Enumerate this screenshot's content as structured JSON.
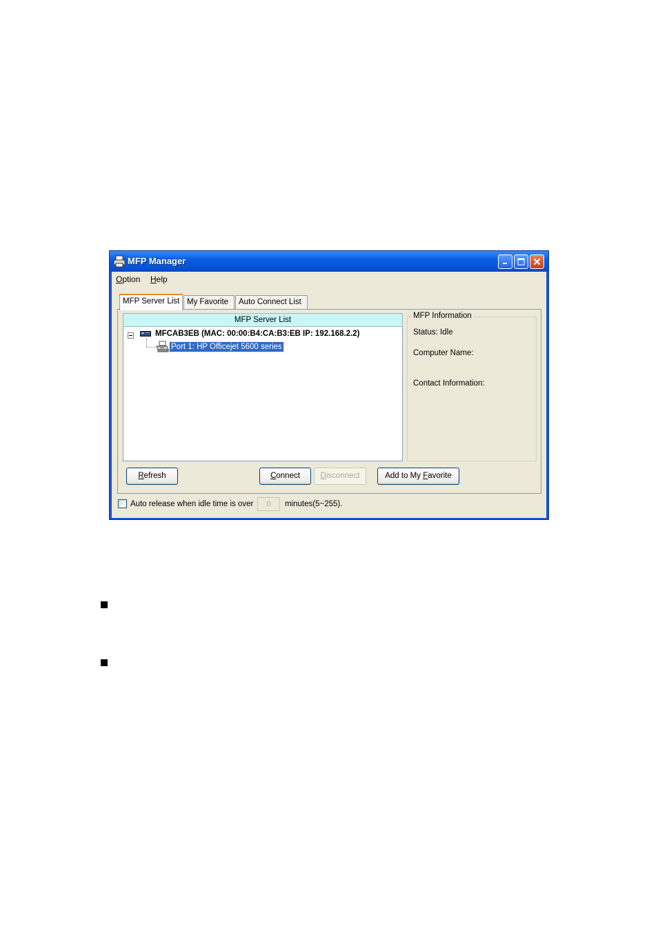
{
  "window": {
    "title": "MFP Manager",
    "colors": {
      "titlebar": "#0654d8",
      "client": "#ece9d8",
      "selection": "#316ac5",
      "list_header": "#c8f5f5"
    }
  },
  "menu": {
    "option": {
      "accel": "O",
      "rest": "ption"
    },
    "help": {
      "accel": "H",
      "rest": "elp"
    }
  },
  "tabs": [
    {
      "label": "MFP Server List",
      "active": true
    },
    {
      "label": "My Favorite",
      "active": false
    },
    {
      "label": "Auto Connect List",
      "active": false
    }
  ],
  "server_list": {
    "header": "MFP Server List",
    "server": {
      "label": "MFCAB3EB (MAC: 00:00:B4:CA:B3:EB   IP: 192.168.2.2)",
      "icon": "server-icon",
      "expanded": true
    },
    "port": {
      "label": "Port 1: HP Officejet 5600 series",
      "icon": "printer-icon",
      "selected": true
    }
  },
  "mfp_information": {
    "caption": "MFP Information",
    "status": "Status: Idle",
    "computer_name": "Computer Name:",
    "contact_information": "Contact Information:"
  },
  "buttons": {
    "refresh": {
      "accel": "R",
      "rest": "efresh"
    },
    "connect": {
      "accel": "C",
      "rest": "onnect"
    },
    "disconnect": {
      "accel": "D",
      "rest": "isconnect",
      "disabled": true
    },
    "add_favorite": {
      "pre": "Add to My ",
      "accel": "F",
      "rest": "avorite"
    }
  },
  "auto_release": {
    "label": "Auto release when idle time is over",
    "checked": false,
    "value": "0",
    "suffix": "minutes(5~255)."
  }
}
